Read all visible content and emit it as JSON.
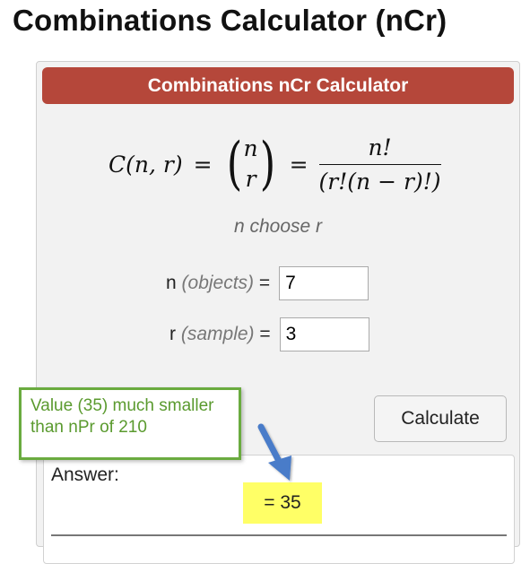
{
  "page": {
    "title": "Combinations Calculator (nCr)"
  },
  "calculator": {
    "header": "Combinations nCr Calculator",
    "formula": {
      "lhs": "C(n, r)",
      "equals": "=",
      "binom_top": "n",
      "binom_bottom": "r",
      "frac_num": "n!",
      "frac_den": "(r!(n − r)!)"
    },
    "subtitle": "n choose r",
    "fields": {
      "n": {
        "label": "n",
        "hint": "(objects)",
        "eq": "=",
        "value": "7"
      },
      "r": {
        "label": "r",
        "hint": "(sample)",
        "eq": "=",
        "value": "3"
      }
    },
    "button_label": "Calculate",
    "answer": {
      "label": "Answer:",
      "value": "= 35",
      "highlight_color": "#ffff66"
    }
  },
  "annotation": {
    "text": "Value (35) much smaller than nPr of 210",
    "border_color": "#6aab3f",
    "arrow_color": "#4a7cc9"
  },
  "colors": {
    "header_bg": "#b5473a",
    "card_bg": "#f2f2f2"
  }
}
